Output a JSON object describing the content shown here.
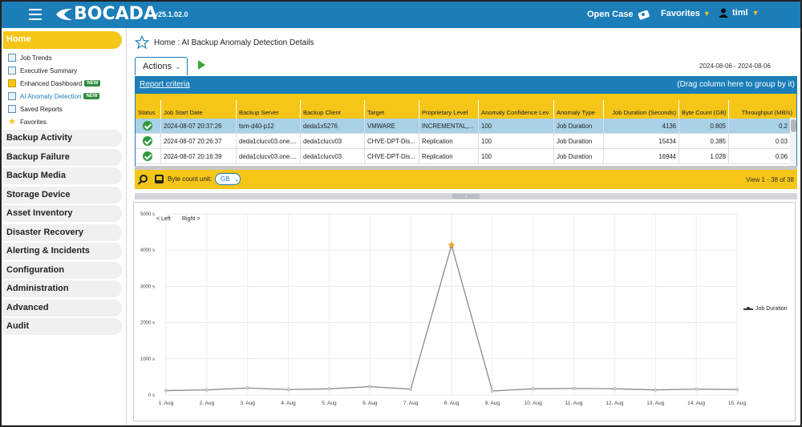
{
  "app": {
    "brand": "BOCADA",
    "version": "v25.1.02.0",
    "open_case": "Open Case",
    "favorites": "Favorites",
    "user": "timl"
  },
  "sidebar": {
    "home": "Home",
    "subitems": [
      {
        "label": "Job Trends",
        "icon": "job-trends-icon"
      },
      {
        "label": "Executive Summary",
        "icon": "executive-summary-icon"
      },
      {
        "label": "Enhanced Dashboard",
        "icon": "dashboard-icon",
        "badge": "NEW"
      },
      {
        "label": "AI Anomaly Detection",
        "icon": "ai-anomaly-icon",
        "badge": "NEW"
      },
      {
        "label": "Saved Reports",
        "icon": "saved-reports-icon"
      },
      {
        "label": "Favorites",
        "icon": "star-icon"
      }
    ],
    "groups": [
      "Backup Activity",
      "Backup Failure",
      "Backup Media",
      "Storage Device",
      "Asset Inventory",
      "Disaster Recovery",
      "Alerting & Incidents",
      "Configuration",
      "Administration",
      "Advanced",
      "Audit"
    ]
  },
  "page": {
    "title": "Home : AI Backup Anomaly Detection Details",
    "actions": "Actions",
    "date_range": "2024-08-06 - 2024-08-06",
    "report_criteria": "Report criteria",
    "group_hint": "(Drag column here to group by it)"
  },
  "grid": {
    "columns": [
      "Status",
      "Job Start Date",
      "Backup Server",
      "Backup Client",
      "Target",
      "Proprietary Level",
      "Anomaly Confidence Lev",
      "Anomaly Type",
      "Job Duration (Seconds)",
      "Byte Count (GB)",
      "Throughput (MB/s)"
    ],
    "rows": [
      {
        "start": "2024-08-07 20:37:26",
        "server": "tsm-d40-p12",
        "client": "deda1x5276",
        "target": "VMWARE",
        "level": "INCREMENTAL,...",
        "confidence": "100",
        "type": "Job Duration",
        "duration": "4136",
        "bytes": "0.805",
        "throughput": "0.2",
        "selected": true
      },
      {
        "start": "2024-08-07 20:26:37",
        "server": "deda1clucv03.one....",
        "client": "deda1clucv03",
        "target": "CHVE-DPT-Dis...",
        "level": "Replication",
        "confidence": "100",
        "type": "Job Duration",
        "duration": "15434",
        "bytes": "0.385",
        "throughput": "0.03",
        "selected": false
      },
      {
        "start": "2024-08-07 20:16:39",
        "server": "deda1clucv03.one....",
        "client": "deda1clucv03",
        "target": "CHVE-DPT-Dis...",
        "level": "Replication",
        "confidence": "100",
        "type": "Job Duration",
        "duration": "16944",
        "bytes": "1.028",
        "throughput": "0.06",
        "selected": false
      }
    ],
    "byte_unit_label": "Byte count unit:",
    "byte_unit_value": "GB",
    "view_count": "View 1 - 38 of 38"
  },
  "chart_nav": {
    "left": "< Left",
    "right": "Right >"
  },
  "chart_data": {
    "type": "line",
    "x": [
      "1. Aug",
      "2. Aug",
      "3. Aug",
      "4. Aug",
      "5. Aug",
      "6. Aug",
      "7. Aug",
      "8. Aug",
      "9. Aug",
      "10. Aug",
      "11. Aug",
      "12. Aug",
      "13. Aug",
      "14. Aug",
      "15. Aug"
    ],
    "series": [
      {
        "name": "Job Duration",
        "values": [
          120,
          140,
          190,
          150,
          170,
          230,
          160,
          4136,
          110,
          170,
          180,
          170,
          140,
          160,
          150
        ],
        "anomaly_index": 7
      }
    ],
    "y_ticks": [
      "0 s",
      "1000 s",
      "2000 s",
      "3000 s",
      "4000 s",
      "5000 s"
    ],
    "ylim": [
      0,
      5000
    ],
    "grid": true,
    "legend": "right",
    "colors": {
      "line": "#8a8a8a",
      "anomaly": "#f5a623",
      "accent": "#1b7eb9",
      "highlight": "#f5c518"
    }
  }
}
